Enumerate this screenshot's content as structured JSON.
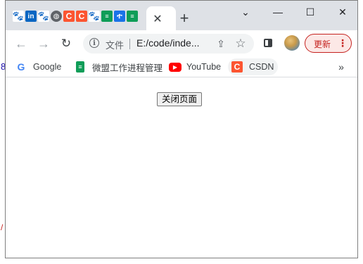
{
  "tabs": {
    "favicons": [
      {
        "icon": "baidu-paw-icon",
        "glyph": "🐾"
      },
      {
        "icon": "linkedin-icon",
        "glyph": "in"
      },
      {
        "icon": "baidu-paw-icon",
        "glyph": "🐾"
      },
      {
        "icon": "globe-icon",
        "glyph": "◍"
      },
      {
        "icon": "csdn-icon",
        "glyph": "C"
      },
      {
        "icon": "csdn-icon",
        "glyph": "C"
      },
      {
        "icon": "baidu-paw-icon",
        "glyph": "🐾"
      },
      {
        "icon": "sheet-icon",
        "glyph": "≡"
      },
      {
        "icon": "app-icon",
        "glyph": "ተ"
      },
      {
        "icon": "sheet-icon",
        "glyph": "≡"
      }
    ],
    "close_glyph": "✕",
    "new_tab_glyph": "+"
  },
  "window_controls": {
    "dropdown_glyph": "⌄",
    "minimize_glyph": "—",
    "maximize_glyph": "☐",
    "close_glyph": "✕"
  },
  "toolbar": {
    "back_glyph": "←",
    "forward_glyph": "→",
    "reload_glyph": "↻",
    "info_glyph": "i",
    "file_label": "文件",
    "url": "E:/code/inde...",
    "share_glyph": "⇪",
    "star_glyph": "☆",
    "update_label": "更新",
    "update_menu_glyph": "⋮"
  },
  "bookmarks": {
    "items": [
      {
        "label": "Google",
        "icon": "google-icon",
        "glyph": "G"
      },
      {
        "label": "微盟工作进程管理",
        "icon": "sheet-icon",
        "glyph": "≡"
      },
      {
        "label": "YouTube",
        "icon": "youtube-icon",
        "glyph": "▶"
      },
      {
        "label": "CSDN",
        "icon": "csdn-icon",
        "glyph": "C"
      }
    ],
    "more_glyph": "»"
  },
  "page": {
    "close_button_label": "关闭页面"
  },
  "colors": {
    "tabstrip_bg": "#dee1e6",
    "accent_red": "#c5221f",
    "csdn_orange": "#fc5531",
    "sheet_green": "#0f9d58"
  }
}
